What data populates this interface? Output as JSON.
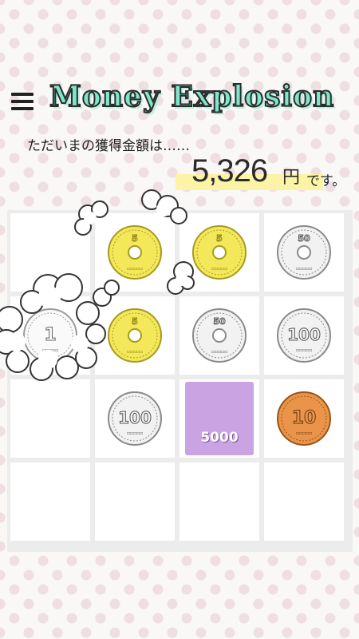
{
  "app": {
    "title": "Money Explosion"
  },
  "status": {
    "prompt": "ただいまの獲得金額は……",
    "amount": "5,326",
    "currency": "円",
    "suffix": "です。"
  },
  "board": {
    "size": 4,
    "tiles": [
      {
        "row": 0,
        "col": 1,
        "kind": "coin",
        "value": "5",
        "color": "gold"
      },
      {
        "row": 0,
        "col": 2,
        "kind": "coin",
        "value": "5",
        "color": "gold"
      },
      {
        "row": 0,
        "col": 3,
        "kind": "coin",
        "value": "50",
        "color": "silver"
      },
      {
        "row": 1,
        "col": 0,
        "kind": "coin",
        "value": "1",
        "color": "white"
      },
      {
        "row": 1,
        "col": 1,
        "kind": "coin",
        "value": "5",
        "color": "gold"
      },
      {
        "row": 1,
        "col": 2,
        "kind": "coin",
        "value": "50",
        "color": "silver"
      },
      {
        "row": 1,
        "col": 3,
        "kind": "coin",
        "value": "100",
        "color": "silver"
      },
      {
        "row": 2,
        "col": 1,
        "kind": "coin",
        "value": "100",
        "color": "silver"
      },
      {
        "row": 2,
        "col": 2,
        "kind": "note",
        "value": "5000",
        "color": "#c9a3e2"
      },
      {
        "row": 2,
        "col": 3,
        "kind": "coin",
        "value": "10",
        "color": "bronze"
      }
    ]
  },
  "icons": {
    "menu": "hamburger-menu-icon",
    "effect": "smoke-cloud-icon"
  }
}
